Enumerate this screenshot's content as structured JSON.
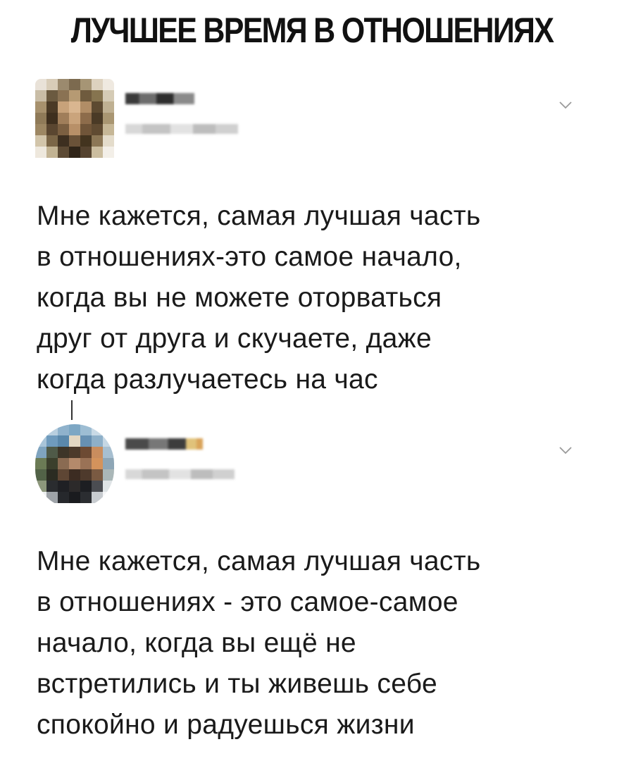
{
  "headline": "ЛУЧШЕЕ ВРЕМЯ В ОТНОШЕНИЯХ",
  "posts": [
    {
      "author_name": "",
      "author_handle": "",
      "lines": [
        "Мне кажется, самая лучшая часть",
        "в отношениях-это самое начало,",
        "когда вы не можете оторваться",
        "друг от друга и скучаете, даже",
        "когда разлучаетесь на час"
      ],
      "menu_icon": "chevron-down-icon"
    },
    {
      "author_name": "",
      "author_handle": "",
      "lines": [
        "Мне кажется, самая лучшая часть",
        "в  отношениях - это самое-самое",
        "начало, когда вы ещё не",
        "встретились и ты живешь себе",
        "спокойно и радуешься жизни"
      ],
      "menu_icon": "chevron-down-icon"
    }
  ],
  "colors": {
    "text": "#1a1a1a",
    "headline": "#111111",
    "chevron": "#9a9a9a",
    "background": "#ffffff"
  }
}
